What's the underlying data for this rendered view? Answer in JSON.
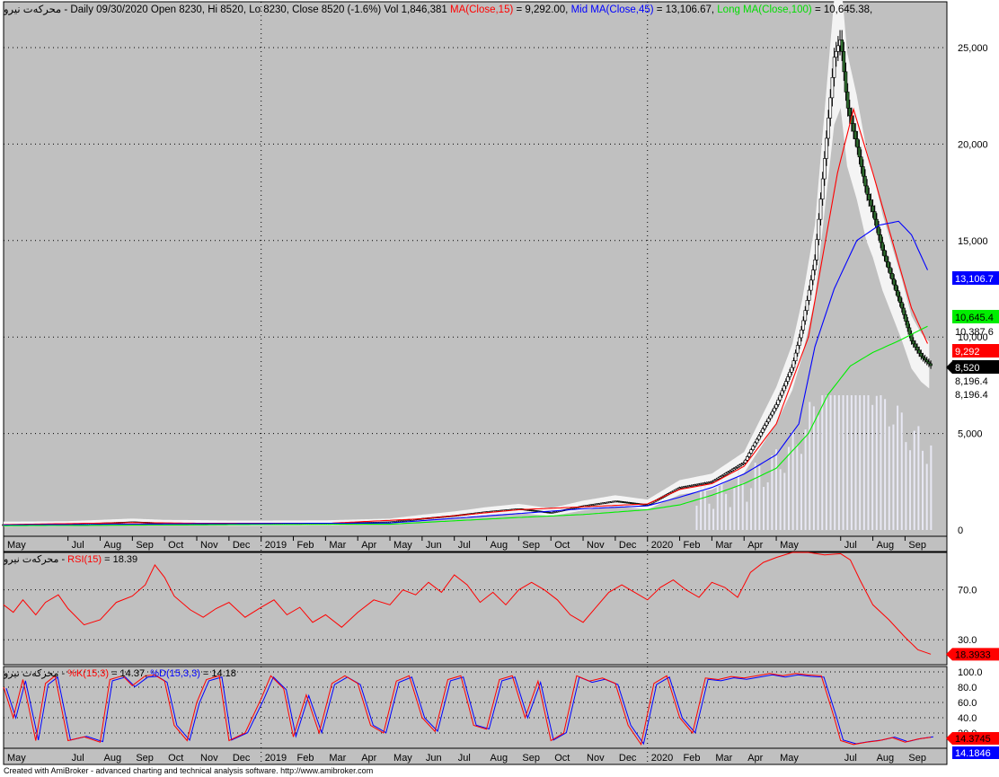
{
  "header": {
    "symbol": "محرکه‌ت نیرو",
    "prefix": " - Daily 09/30/2020 Open 8230, Hi 8520, Lo 8230, Close 8520 (-1.6%) Vol 1,846,381 ",
    "ma": "MA(Close,15)",
    "ma_val": " = 9,292.00, ",
    "mid": "Mid MA(Close,45)",
    "mid_val": " = 13,106.67, ",
    "long": "Long MA(Close,100)",
    "long_val": " = 10,645.38,"
  },
  "rsi_header": {
    "symbol": "محرکه‌ت نیرو",
    "sep": " - ",
    "label": "RSI(15)",
    "val": " = 18.39"
  },
  "stoch_header": {
    "symbol": "محرکه‌ت نیرو",
    "sep": " - ",
    "k": "%K(15,3)",
    "k_val": " = 14.37, ",
    "d": "%D(15,3,3)",
    "d_val": " = 14.18"
  },
  "footer": "Created with AmiBroker - advanced charting and technical analysis software. http://www.amibroker.com",
  "colors": {
    "background": "#c0c0c0",
    "ma": "#ff0000",
    "mid": "#0000ff",
    "long": "#00ee00",
    "band": "#f4f4f4",
    "up": "#000000",
    "down": "#2e6b2e"
  },
  "chart_data": [
    {
      "type": "line",
      "panel": "price",
      "x_labels": [
        "May",
        "Jul",
        "Aug",
        "Sep",
        "Oct",
        "Nov",
        "Dec",
        "2019",
        "Feb",
        "Mar",
        "Apr",
        "May",
        "Jun",
        "Jul",
        "Aug",
        "Sep",
        "Oct",
        "Nov",
        "Dec",
        "2020",
        "Feb",
        "Mar",
        "Apr",
        "May",
        "Jul",
        "Aug",
        "Sep"
      ],
      "x_months": [
        0,
        2,
        3,
        4,
        5,
        6,
        7,
        8,
        9,
        10,
        11,
        12,
        13,
        14,
        15,
        16,
        17,
        18,
        19,
        20,
        21,
        22,
        23,
        24,
        26,
        27,
        28
      ],
      "x_range_months": [
        0,
        29.3
      ],
      "y_ticks": [
        0,
        5000,
        10000,
        15000,
        20000,
        25000
      ],
      "y_tick_labels": [
        "0",
        "5,000",
        "10,000",
        "15,000",
        "20,000",
        "25,000"
      ],
      "ylim": [
        0,
        27000
      ],
      "price_points": [
        [
          0,
          280
        ],
        [
          2,
          300
        ],
        [
          4,
          420
        ],
        [
          5,
          360
        ],
        [
          6,
          350
        ],
        [
          7,
          330
        ],
        [
          8,
          330
        ],
        [
          10,
          340
        ],
        [
          12,
          420
        ],
        [
          13,
          600
        ],
        [
          14,
          750
        ],
        [
          15,
          950
        ],
        [
          16,
          1100
        ],
        [
          17,
          900
        ],
        [
          18,
          1250
        ],
        [
          19,
          1500
        ],
        [
          20,
          1300
        ],
        [
          21,
          2200
        ],
        [
          22,
          2500
        ],
        [
          23,
          3500
        ],
        [
          24,
          6500
        ],
        [
          24.5,
          8500
        ],
        [
          24.8,
          10500
        ],
        [
          25.2,
          14000
        ],
        [
          25.8,
          24500
        ],
        [
          26.0,
          25500
        ],
        [
          26.2,
          22000
        ],
        [
          26.5,
          20000
        ],
        [
          26.8,
          17500
        ],
        [
          27.0,
          16500
        ],
        [
          27.3,
          14500
        ],
        [
          27.6,
          13000
        ],
        [
          27.9,
          11500
        ],
        [
          28.2,
          9800
        ],
        [
          28.5,
          9000
        ],
        [
          28.8,
          8520
        ]
      ],
      "series": [
        {
          "name": "MA(Close,15)",
          "points": [
            [
              0,
              280
            ],
            [
              4,
              380
            ],
            [
              6,
              350
            ],
            [
              10,
              340
            ],
            [
              13,
              580
            ],
            [
              16,
              1050
            ],
            [
              18,
              1200
            ],
            [
              20,
              1350
            ],
            [
              21,
              2100
            ],
            [
              22,
              2400
            ],
            [
              23,
              3300
            ],
            [
              24,
              5500
            ],
            [
              25,
              10000
            ],
            [
              25.9,
              18500
            ],
            [
              26.4,
              21800
            ],
            [
              27,
              18500
            ],
            [
              27.6,
              15000
            ],
            [
              28.2,
              11500
            ],
            [
              28.8,
              9292
            ]
          ]
        },
        {
          "name": "Mid MA(Close,45)",
          "points": [
            [
              0,
              260
            ],
            [
              6,
              320
            ],
            [
              12,
              360
            ],
            [
              16,
              850
            ],
            [
              18,
              1100
            ],
            [
              20,
              1250
            ],
            [
              21,
              1700
            ],
            [
              22,
              2200
            ],
            [
              23,
              2900
            ],
            [
              24,
              3900
            ],
            [
              24.7,
              5500
            ],
            [
              25.2,
              9500
            ],
            [
              25.8,
              12500
            ],
            [
              26.5,
              15000
            ],
            [
              27.2,
              15800
            ],
            [
              27.8,
              16000
            ],
            [
              28.2,
              15300
            ],
            [
              28.8,
              13107
            ]
          ]
        },
        {
          "name": "Long MA(Close,100)",
          "points": [
            [
              0,
              220
            ],
            [
              8,
              280
            ],
            [
              12,
              300
            ],
            [
              16,
              650
            ],
            [
              18,
              800
            ],
            [
              20,
              1050
            ],
            [
              21,
              1300
            ],
            [
              22,
              1800
            ],
            [
              23,
              2400
            ],
            [
              24,
              3200
            ],
            [
              25,
              5000
            ],
            [
              25.6,
              7000
            ],
            [
              26.3,
              8500
            ],
            [
              27,
              9200
            ],
            [
              27.8,
              9800
            ],
            [
              28.8,
              10645
            ]
          ]
        }
      ],
      "value_labels": [
        "13,106.7",
        "10,645.4",
        "10,387.6",
        "9,292",
        "8,520",
        "8,196.4",
        "8,196.4"
      ]
    },
    {
      "type": "line",
      "panel": "rsi",
      "series": [
        {
          "name": "RSI(15)",
          "last": 18.3933
        }
      ],
      "y_ticks": [
        30,
        70
      ],
      "y_tick_labels": [
        "30.0",
        "70.0"
      ],
      "ylim": [
        10,
        100
      ],
      "points": [
        [
          0,
          58
        ],
        [
          0.3,
          52
        ],
        [
          0.6,
          62
        ],
        [
          1,
          50
        ],
        [
          1.3,
          60
        ],
        [
          1.7,
          66
        ],
        [
          2,
          55
        ],
        [
          2.5,
          42
        ],
        [
          3,
          46
        ],
        [
          3.5,
          60
        ],
        [
          4,
          65
        ],
        [
          4.4,
          74
        ],
        [
          4.7,
          90
        ],
        [
          5,
          80
        ],
        [
          5.3,
          65
        ],
        [
          5.8,
          54
        ],
        [
          6.2,
          48
        ],
        [
          6.6,
          55
        ],
        [
          7,
          60
        ],
        [
          7.5,
          48
        ],
        [
          8,
          56
        ],
        [
          8.4,
          62
        ],
        [
          8.8,
          50
        ],
        [
          9.2,
          56
        ],
        [
          9.6,
          44
        ],
        [
          10,
          50
        ],
        [
          10.5,
          40
        ],
        [
          11,
          52
        ],
        [
          11.5,
          62
        ],
        [
          12,
          58
        ],
        [
          12.4,
          70
        ],
        [
          12.8,
          66
        ],
        [
          13.2,
          76
        ],
        [
          13.6,
          68
        ],
        [
          14,
          82
        ],
        [
          14.4,
          74
        ],
        [
          14.8,
          60
        ],
        [
          15.2,
          68
        ],
        [
          15.6,
          58
        ],
        [
          16,
          70
        ],
        [
          16.4,
          76
        ],
        [
          16.8,
          70
        ],
        [
          17.2,
          62
        ],
        [
          17.6,
          50
        ],
        [
          18,
          44
        ],
        [
          18.4,
          56
        ],
        [
          18.8,
          68
        ],
        [
          19.2,
          74
        ],
        [
          19.6,
          68
        ],
        [
          20,
          62
        ],
        [
          20.4,
          72
        ],
        [
          20.8,
          78
        ],
        [
          21.2,
          70
        ],
        [
          21.6,
          64
        ],
        [
          22,
          76
        ],
        [
          22.4,
          72
        ],
        [
          22.8,
          64
        ],
        [
          23.2,
          84
        ],
        [
          23.6,
          92
        ],
        [
          24,
          96
        ],
        [
          24.5,
          100
        ],
        [
          25,
          100
        ],
        [
          25.5,
          98
        ],
        [
          26,
          99
        ],
        [
          26.3,
          94
        ],
        [
          26.6,
          78
        ],
        [
          27,
          58
        ],
        [
          27.5,
          46
        ],
        [
          28,
          32
        ],
        [
          28.4,
          22
        ],
        [
          28.8,
          18.39
        ]
      ]
    },
    {
      "type": "line",
      "panel": "stochastic",
      "series": [
        {
          "name": "%K(15,3)",
          "last": 14.3745
        },
        {
          "name": "%D(15,3,3)",
          "last": 14.1846
        }
      ],
      "y_ticks": [
        20,
        40,
        60,
        80,
        100
      ],
      "y_tick_labels": [
        "20.0",
        "40.0",
        "60.0",
        "80.0",
        "100.0"
      ],
      "ylim": [
        0,
        100
      ],
      "points": [
        [
          0,
          80
        ],
        [
          0.3,
          40
        ],
        [
          0.6,
          90
        ],
        [
          1,
          10
        ],
        [
          1.3,
          85
        ],
        [
          1.6,
          95
        ],
        [
          2,
          10
        ],
        [
          2.5,
          15
        ],
        [
          3,
          8
        ],
        [
          3.3,
          90
        ],
        [
          3.7,
          95
        ],
        [
          4,
          82
        ],
        [
          4.4,
          95
        ],
        [
          4.7,
          96
        ],
        [
          5,
          88
        ],
        [
          5.3,
          30
        ],
        [
          5.7,
          10
        ],
        [
          6,
          60
        ],
        [
          6.3,
          90
        ],
        [
          6.7,
          95
        ],
        [
          7,
          10
        ],
        [
          7.5,
          20
        ],
        [
          8,
          65
        ],
        [
          8.3,
          95
        ],
        [
          8.7,
          78
        ],
        [
          9,
          15
        ],
        [
          9.4,
          70
        ],
        [
          9.8,
          20
        ],
        [
          10.2,
          85
        ],
        [
          10.6,
          95
        ],
        [
          11,
          85
        ],
        [
          11.4,
          30
        ],
        [
          11.8,
          20
        ],
        [
          12.2,
          88
        ],
        [
          12.6,
          95
        ],
        [
          13,
          40
        ],
        [
          13.4,
          22
        ],
        [
          13.8,
          90
        ],
        [
          14.2,
          95
        ],
        [
          14.6,
          30
        ],
        [
          15,
          25
        ],
        [
          15.4,
          90
        ],
        [
          15.8,
          95
        ],
        [
          16.2,
          40
        ],
        [
          16.6,
          88
        ],
        [
          17,
          10
        ],
        [
          17.4,
          20
        ],
        [
          17.8,
          95
        ],
        [
          18.2,
          88
        ],
        [
          18.6,
          92
        ],
        [
          19,
          85
        ],
        [
          19.4,
          30
        ],
        [
          19.8,
          5
        ],
        [
          20.2,
          85
        ],
        [
          20.6,
          95
        ],
        [
          21,
          40
        ],
        [
          21.4,
          20
        ],
        [
          21.8,
          92
        ],
        [
          22.2,
          90
        ],
        [
          22.6,
          94
        ],
        [
          23,
          92
        ],
        [
          23.4,
          95
        ],
        [
          23.8,
          98
        ],
        [
          24.2,
          95
        ],
        [
          24.6,
          98
        ],
        [
          25,
          96
        ],
        [
          25.4,
          95
        ],
        [
          25.8,
          40
        ],
        [
          26,
          10
        ],
        [
          26.4,
          5
        ],
        [
          26.8,
          8
        ],
        [
          27.2,
          10
        ],
        [
          27.6,
          14
        ],
        [
          28,
          8
        ],
        [
          28.4,
          12
        ],
        [
          28.8,
          14.37
        ]
      ]
    }
  ]
}
